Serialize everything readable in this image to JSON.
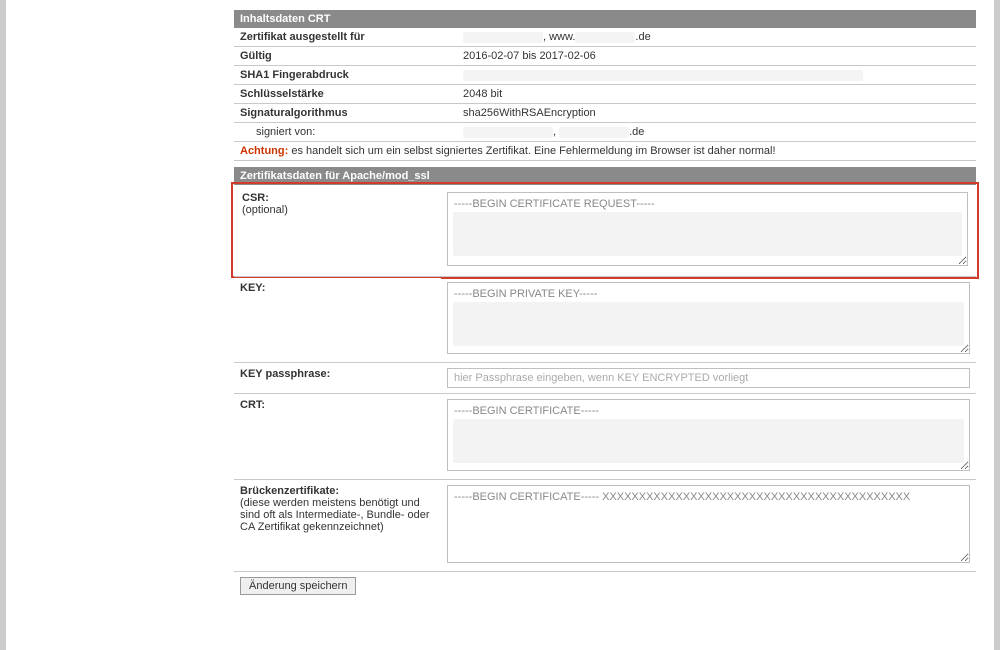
{
  "sections": {
    "crt_header": "Inhaltsdaten CRT",
    "apache_header": "Zertifikatsdaten für Apache/mod_ssl"
  },
  "crt": {
    "issued_for_label": "Zertifikat ausgestellt für",
    "issued_for_prefix": ", www.",
    "issued_for_suffix": ".de",
    "valid_label": "Gültig",
    "valid_value": "2016-02-07 bis 2017-02-06",
    "sha1_label": "SHA1 Fingerabdruck",
    "keystrength_label": "Schlüsselstärke",
    "keystrength_value": "2048 bit",
    "sigalg_label": "Signaturalgorithmus",
    "sigalg_value": "sha256WithRSAEncryption",
    "signed_by_label": "signiert von:",
    "signed_by_sep": ", ",
    "signed_by_suffix": ".de"
  },
  "warning": {
    "label": "Achtung:",
    "text": " es handelt sich um ein selbst signiertes Zertifikat. Eine Fehlermeldung im Browser ist daher normal!"
  },
  "form": {
    "csr_label": "CSR:",
    "csr_sub": "(optional)",
    "csr_value": "-----BEGIN CERTIFICATE REQUEST-----",
    "key_label": "KEY:",
    "key_value": "-----BEGIN PRIVATE KEY-----",
    "pass_label": "KEY passphrase:",
    "pass_placeholder": "hier Passphrase eingeben, wenn KEY ENCRYPTED vorliegt",
    "crt_label": "CRT:",
    "crt_value": "-----BEGIN CERTIFICATE-----",
    "bridge_label": "Brückenzertifikate:",
    "bridge_sub": "(diese werden meistens benötigt und sind oft als Intermediate-, Bundle- oder CA Zertifikat gekennzeichnet)",
    "bridge_value": "-----BEGIN CERTIFICATE----- XXXXXXXXXXXXXXXXXXXXXXXXXXXXXXXXXXXXXXXXXX"
  },
  "actions": {
    "save": "Änderung speichern"
  }
}
